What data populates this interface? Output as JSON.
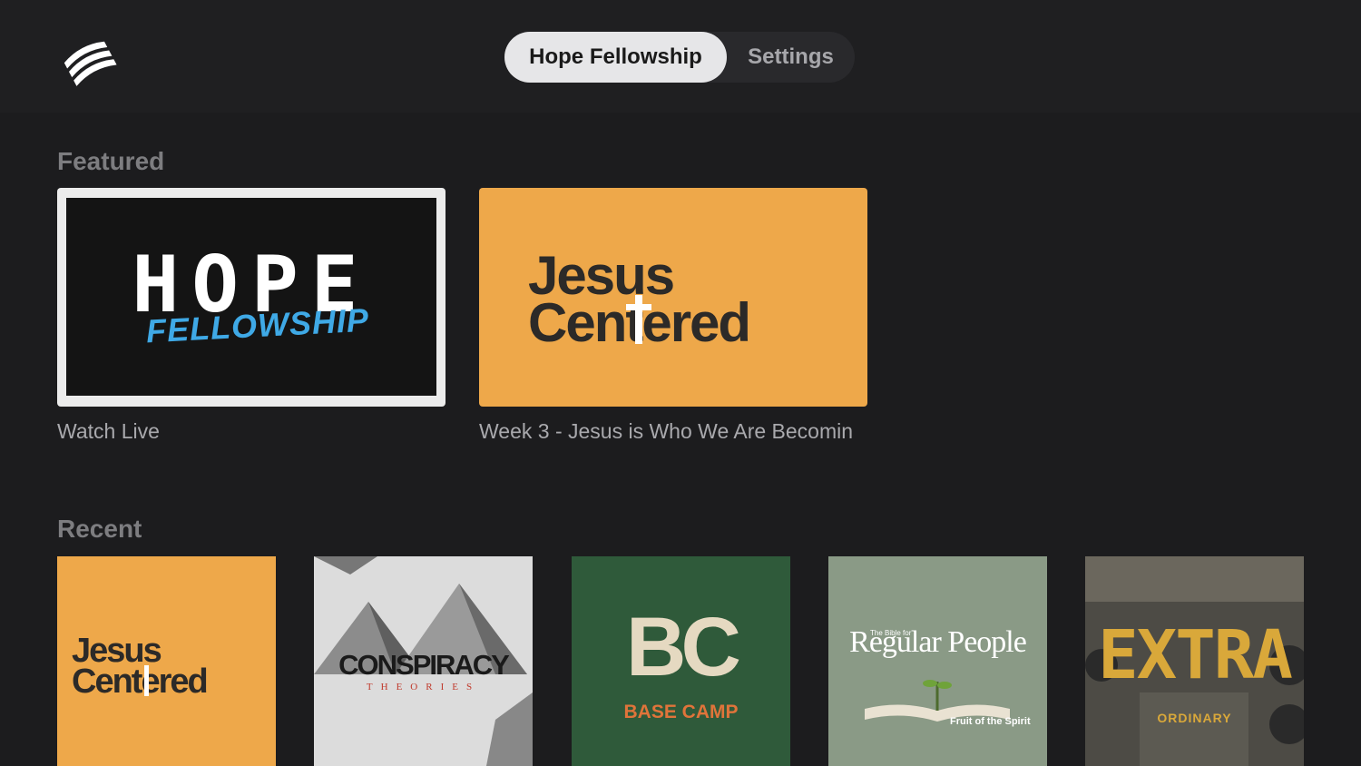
{
  "header": {
    "logo_icon": "church-logo-icon",
    "tabs": [
      {
        "label": "Hope Fellowship",
        "active": true
      },
      {
        "label": "Settings",
        "active": false
      }
    ]
  },
  "featured": {
    "title": "Featured",
    "items": [
      {
        "caption": "Watch Live",
        "art_text_1": "HOPE",
        "art_text_2": "FELLOWSHIP"
      },
      {
        "caption": "Week 3 - Jesus is Who We Are Becomin",
        "art_text_1": "Jesus",
        "art_text_2": "Centered"
      }
    ]
  },
  "recent": {
    "title": "Recent",
    "items": [
      {
        "art_text_1": "Jesus",
        "art_text_2": "Centered"
      },
      {
        "art_text_1": "CONSPIRACY",
        "art_text_2": "THEORIES"
      },
      {
        "art_text_1": "BC",
        "art_text_2": "BASE CAMP"
      },
      {
        "art_text_1": "The Bible for",
        "art_text_2": "Regular People",
        "art_text_3": "Fruit of the Spirit"
      },
      {
        "art_text_1": "EXTRA",
        "art_text_2": "ORDINARY"
      }
    ]
  },
  "colors": {
    "background": "#1c1c1e",
    "accent_orange": "#eea84a",
    "fellowship_blue": "#3fa9e6",
    "basecamp_green": "#2f5a3a",
    "basecamp_orange": "#e0743a"
  }
}
